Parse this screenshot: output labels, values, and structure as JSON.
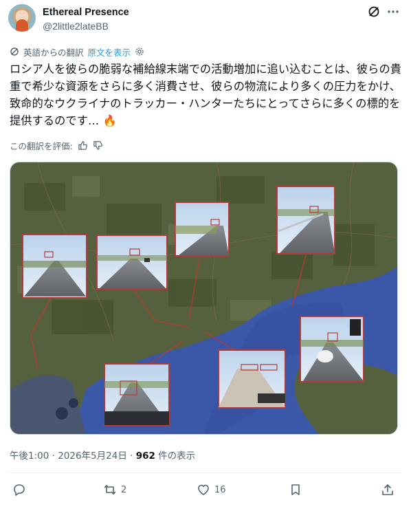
{
  "post": {
    "author_name": "Ethereal Presence",
    "author_handle": "@2little2lateBB",
    "translation_label": "英語からの翻訳",
    "show_original_label": "原文を表示",
    "text": "ロシア人を彼らの脆弱な補給線末端での活動増加に追い込むことは、彼らの貴重で希少な資源をさらに多く消費させ、彼らの物流により多くの圧力をかけ、致命的なウクライナのトラッカー・ハンターたちにとってさらに多くの標的を提供するのです… 🔥",
    "rate_translation_label": "この翻訳を評価:",
    "timestamp": "午後1:00 · 2026年5月24日 · ",
    "views_count": "962",
    "views_label": " 件の表示"
  },
  "actions": {
    "reposts": "2",
    "likes": "16"
  },
  "icons": {
    "header": [
      "grok-icon",
      "more-icon"
    ],
    "translate": [
      "translate-icon",
      "settings-icon"
    ],
    "rating": [
      "thumbs-up-icon",
      "thumbs-down-icon"
    ],
    "actions": [
      "reply-icon",
      "repost-icon",
      "like-icon",
      "bookmark-icon",
      "share-icon"
    ]
  },
  "colors": {
    "accent": "#1d9bf0",
    "secondary_text": "#536471",
    "sea": "#3b58a8",
    "land": "#4f5a3c",
    "frame": "#b33a3a"
  }
}
